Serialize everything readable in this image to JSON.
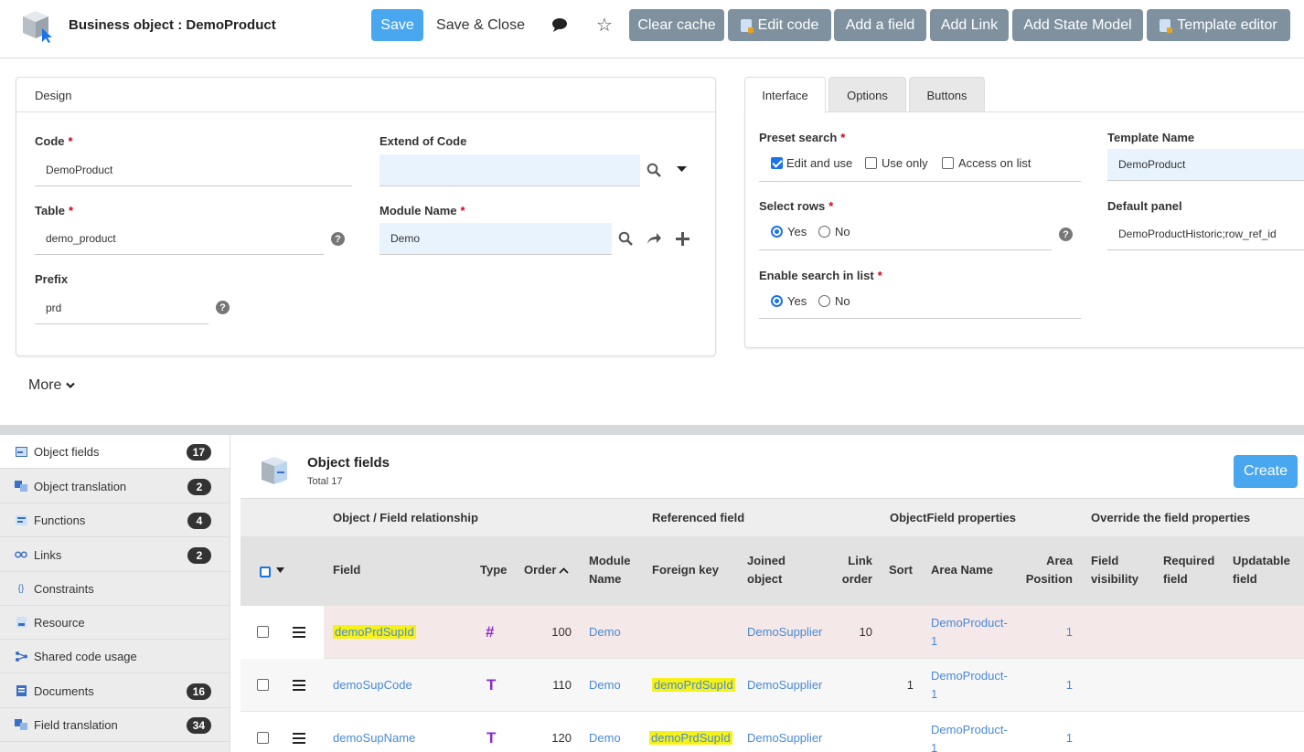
{
  "header": {
    "title": "Business object : DemoProduct",
    "save": "Save",
    "save_close": "Save & Close",
    "clear_cache": "Clear cache",
    "edit_code": "Edit code",
    "add_field": "Add a field",
    "add_link": "Add Link",
    "add_state_model": "Add State Model",
    "template_editor": "Template editor"
  },
  "design": {
    "title": "Design",
    "code_label": "Code",
    "code_value": "DemoProduct",
    "extend_label": "Extend of Code",
    "extend_value": "",
    "table_label": "Table",
    "table_value": "demo_product",
    "module_label": "Module Name",
    "module_value": "Demo",
    "prefix_label": "Prefix",
    "prefix_value": "prd",
    "more": "More"
  },
  "tabs": [
    "Interface",
    "Options",
    "Buttons"
  ],
  "interface": {
    "preset_label": "Preset search",
    "preset_options": [
      "Edit and use",
      "Use only",
      "Access on list"
    ],
    "select_rows_label": "Select rows",
    "yes": "Yes",
    "no": "No",
    "enable_search_label": "Enable search in list",
    "template_label": "Template Name",
    "template_value": "DemoProduct",
    "default_panel_label": "Default panel",
    "default_panel_value": "DemoProductHistoric;row_ref_id"
  },
  "sidebar": [
    {
      "label": "Object fields",
      "count": "17"
    },
    {
      "label": "Object translation",
      "count": "2"
    },
    {
      "label": "Functions",
      "count": "4"
    },
    {
      "label": "Links",
      "count": "2"
    },
    {
      "label": "Constraints",
      "count": ""
    },
    {
      "label": "Resource",
      "count": ""
    },
    {
      "label": "Shared code usage",
      "count": ""
    },
    {
      "label": "Documents",
      "count": "16"
    },
    {
      "label": "Field translation",
      "count": "34"
    }
  ],
  "list": {
    "title": "Object fields",
    "total": "Total 17",
    "create": "Create",
    "groups": [
      "Object / Field relationship",
      "Referenced field",
      "ObjectField properties",
      "Override the field properties"
    ],
    "columns": {
      "field": "Field",
      "type": "Type",
      "order": "Order",
      "module1": "Module",
      "module2": "Name",
      "fk": "Foreign key",
      "joined1": "Joined",
      "joined2": "object",
      "link1": "Link",
      "link2": "order",
      "sort": "Sort",
      "area": "Area Name",
      "areapos1": "Area",
      "areapos2": "Position",
      "vis1": "Field",
      "vis2": "visibility",
      "req1": "Required",
      "req2": "field",
      "upd1": "Updatable",
      "upd2": "field"
    },
    "rows": [
      {
        "field": "demoPrdSupId",
        "type": "#",
        "order": "100",
        "module": "Demo",
        "fk": "",
        "joined": "DemoSupplier",
        "link_order": "10",
        "sort": "",
        "area1": "DemoProduct-",
        "area2": "1",
        "pos": "1"
      },
      {
        "field": "demoSupCode",
        "type": "T",
        "order": "110",
        "module": "Demo",
        "fk": "demoPrdSupId",
        "joined": "DemoSupplier",
        "link_order": "",
        "sort": "1",
        "area1": "DemoProduct-",
        "area2": "1",
        "pos": "1"
      },
      {
        "field": "demoSupName",
        "type": "T",
        "order": "120",
        "module": "Demo",
        "fk": "demoPrdSupId",
        "joined": "DemoSupplier",
        "link_order": "",
        "sort": "",
        "area1": "DemoProduct-",
        "area2": "1",
        "pos": "1"
      }
    ]
  }
}
